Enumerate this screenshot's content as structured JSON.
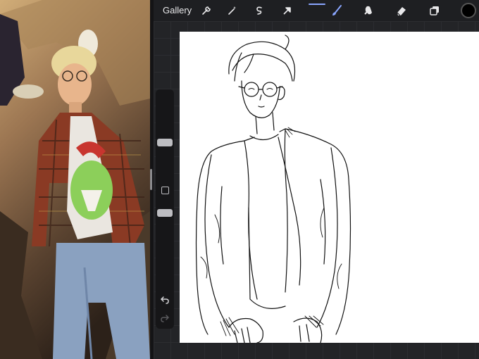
{
  "toolbar": {
    "gallery_label": "Gallery",
    "left_tools": [
      "wrench-icon",
      "magic-wand-icon",
      "selection-icon",
      "transform-arrow-icon"
    ],
    "right_tools": [
      "brush-icon",
      "smudge-icon",
      "eraser-icon",
      "layers-icon"
    ],
    "active_tool": "brush-icon",
    "current_color": "#000000"
  },
  "sidebar": {
    "brush_size_level": 0.25,
    "opacity_level": 0.45,
    "buttons": [
      "modify-button",
      "undo-button",
      "redo-button"
    ]
  },
  "colors": {
    "accent": "#8aa6ff",
    "toolbar_bg": "#1e1f22",
    "canvas_bg": "#ffffff"
  }
}
